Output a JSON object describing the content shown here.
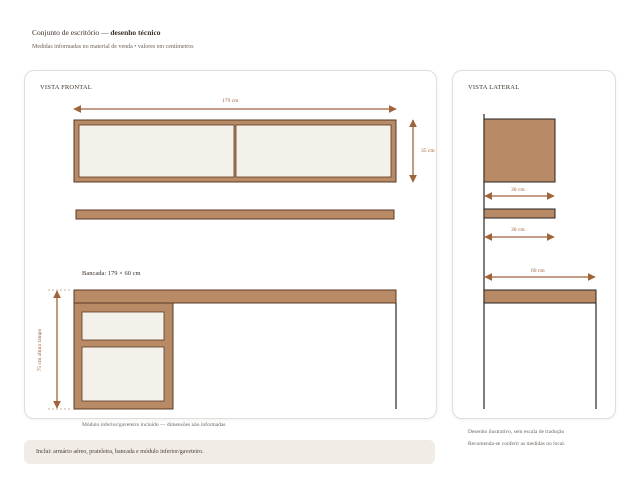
{
  "header": {
    "title": "Conjunto de escritório",
    "title_suffix": "desenho técnico",
    "subtitle": "Medidas informadas no material de venda • valores em centímetros"
  },
  "front_view": {
    "label": "VISTA FRONTAL",
    "cabinet_width_label": "179 cm",
    "cabinet_height_label": "35 cm",
    "desk_label": "Bancada: 179 × 60 cm",
    "desk_height_label": "75 cm altura tampo",
    "lower_module_note": "Módulo inferior/gaveteiro incluído — dimensões não informadas"
  },
  "side_view": {
    "label": "VISTA LATERAL",
    "cabinet_depth_label": "30 cm",
    "shelf_depth_label": "30 cm",
    "desk_depth_label": "60 cm"
  },
  "side_notes": {
    "line1": "Desenho ilustrativo, sem escala de tradução",
    "line2": "Recomenda-se conferir as medidas no local."
  },
  "footer": {
    "text": "Inclui: armário aéreo, prateleira, bancada e módulo inferior/gaveteiro."
  },
  "colors": {
    "wood": "#b88a66",
    "wood_dark": "#5a3a24",
    "panel_fill": "#f4f0ea",
    "dimension": "#a0643a"
  }
}
